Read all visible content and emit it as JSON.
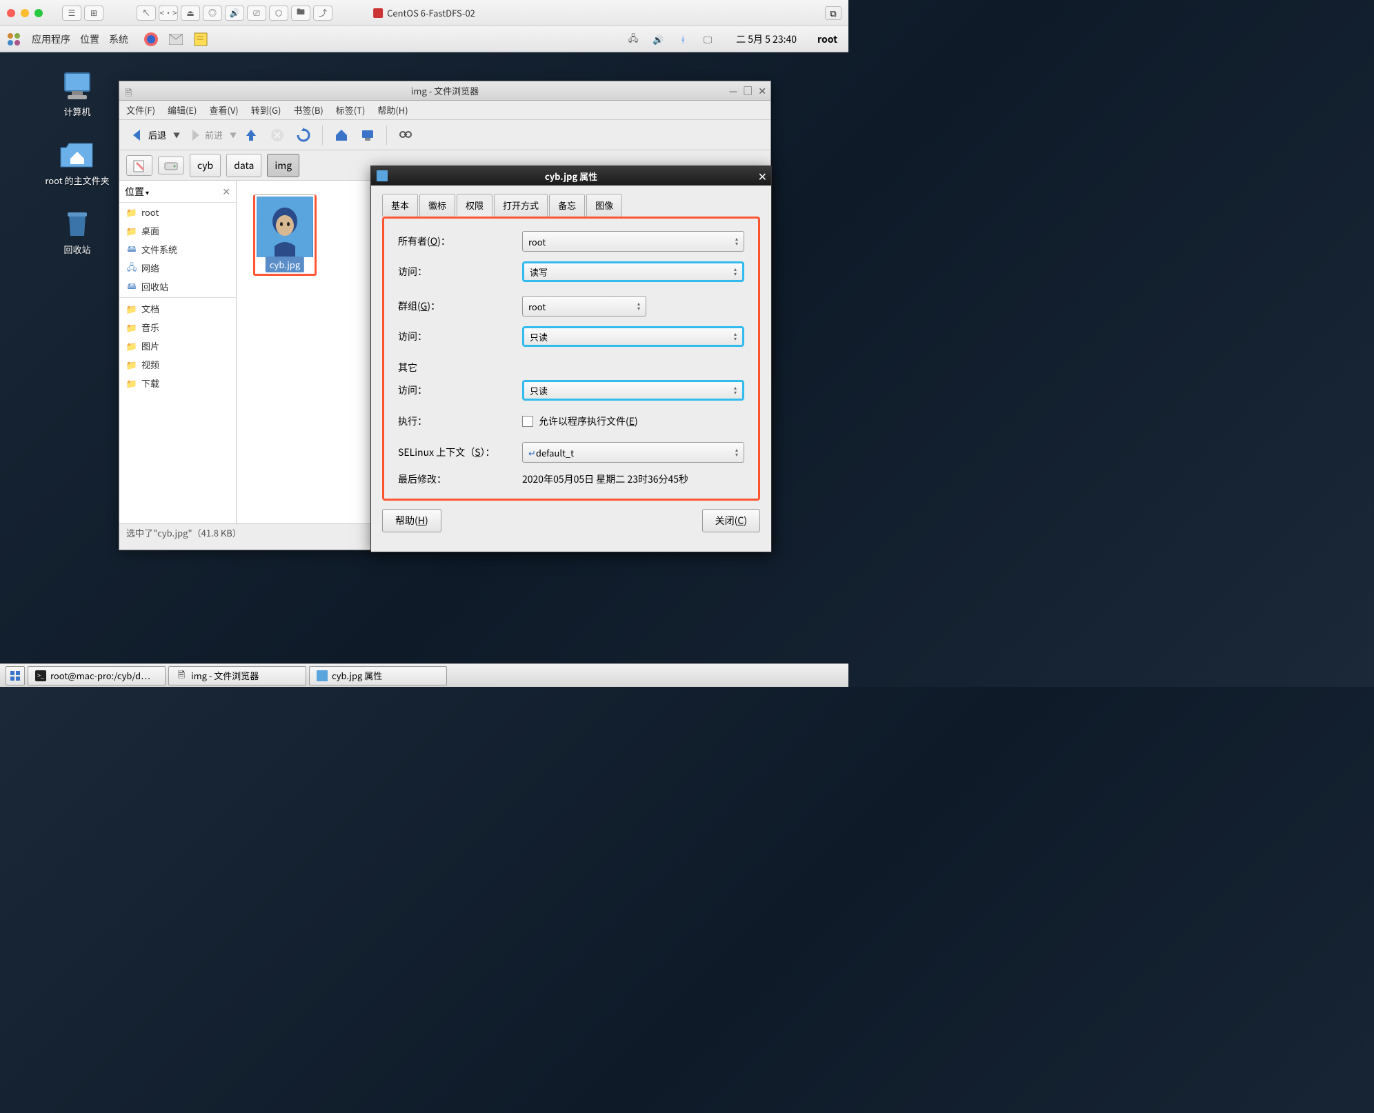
{
  "mac_titlebar": {
    "title": "CentOS 6-FastDFS-02"
  },
  "gnome_panel": {
    "menus": [
      "应用程序",
      "位置",
      "系统"
    ],
    "datetime": "二  5月  5 23:40",
    "user": "root"
  },
  "desktop": {
    "computer": "计算机",
    "home": "root 的主文件夹",
    "trash": "回收站"
  },
  "filebrowser": {
    "title": "img - 文件浏览器",
    "menus": [
      "文件(F)",
      "编辑(E)",
      "查看(V)",
      "转到(G)",
      "书签(B)",
      "标签(T)",
      "帮助(H)"
    ],
    "back": "后退",
    "forward": "前进",
    "path": [
      "cyb",
      "data",
      "img"
    ],
    "sidebar_header": "位置",
    "sidebar": {
      "places": [
        "root",
        "桌面",
        "文件系统",
        "网络",
        "回收站"
      ],
      "bookmarks": [
        "文档",
        "音乐",
        "图片",
        "视频",
        "下载"
      ]
    },
    "file": {
      "name": "cyb.jpg"
    },
    "status": "选中了\"cyb.jpg\"（41.8 KB）"
  },
  "properties": {
    "title": "cyb.jpg 属性",
    "tabs": [
      "基本",
      "徽标",
      "权限",
      "打开方式",
      "备忘",
      "图像"
    ],
    "active_tab": 2,
    "owner_label": "所有者(O)：",
    "owner_value": "root",
    "access_label": "访问：",
    "owner_access": "读写",
    "group_label": "群组(G)：",
    "group_value": "root",
    "group_access": "只读",
    "other_label": "其它",
    "other_access": "只读",
    "execute_label": "执行：",
    "execute_text": "允许以程序执行文件(E)",
    "selinux_label": "SELinux 上下文（S）：",
    "selinux_value": "default_t",
    "modified_label": "最后修改：",
    "modified_value": "2020年05月05日 星期二 23时36分45秒",
    "help_btn": "帮助(H)",
    "close_btn": "关闭(C)"
  },
  "taskbar": {
    "items": [
      "root@mac-pro:/cyb/d…",
      "img - 文件浏览器",
      "cyb.jpg 属性"
    ]
  }
}
